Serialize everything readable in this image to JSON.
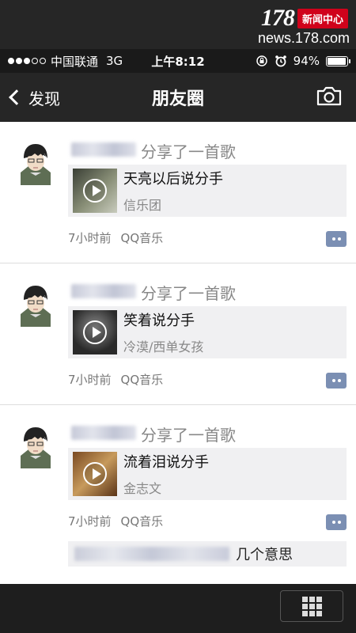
{
  "watermark": {
    "number": "178",
    "tag": "新闻中心",
    "url": "news.178.com"
  },
  "status_bar": {
    "carrier": "中国联通",
    "network": "3G",
    "time": "上午8:12",
    "battery": "94%",
    "battery_level": 0.94
  },
  "nav": {
    "back_label": "发现",
    "title": "朋友圈"
  },
  "posts": [
    {
      "action": "分享了一首歌",
      "song_title": "天亮以后说分手",
      "song_artist": "信乐团",
      "time_ago": "7小时前",
      "source": "QQ音乐"
    },
    {
      "action": "分享了一首歌",
      "song_title": "笑着说分手",
      "song_artist": "冷漠/西单女孩",
      "time_ago": "7小时前",
      "source": "QQ音乐"
    },
    {
      "action": "分享了一首歌",
      "song_title": "流着泪说分手",
      "song_artist": "金志文",
      "time_ago": "7小时前",
      "source": "QQ音乐"
    }
  ],
  "comment": {
    "text": "几个意思"
  },
  "icons": {
    "back": "chevron-left-icon",
    "camera": "camera-icon",
    "comment": "comment-icon",
    "play": "play-icon",
    "keyboard": "grid-icon"
  },
  "colors": {
    "navbar": "#262626",
    "feed_bg": "#ffffff",
    "card_bg": "#f0f0f2",
    "comment_btn": "#7b8fb3",
    "watermark_tag": "#d0021b"
  }
}
